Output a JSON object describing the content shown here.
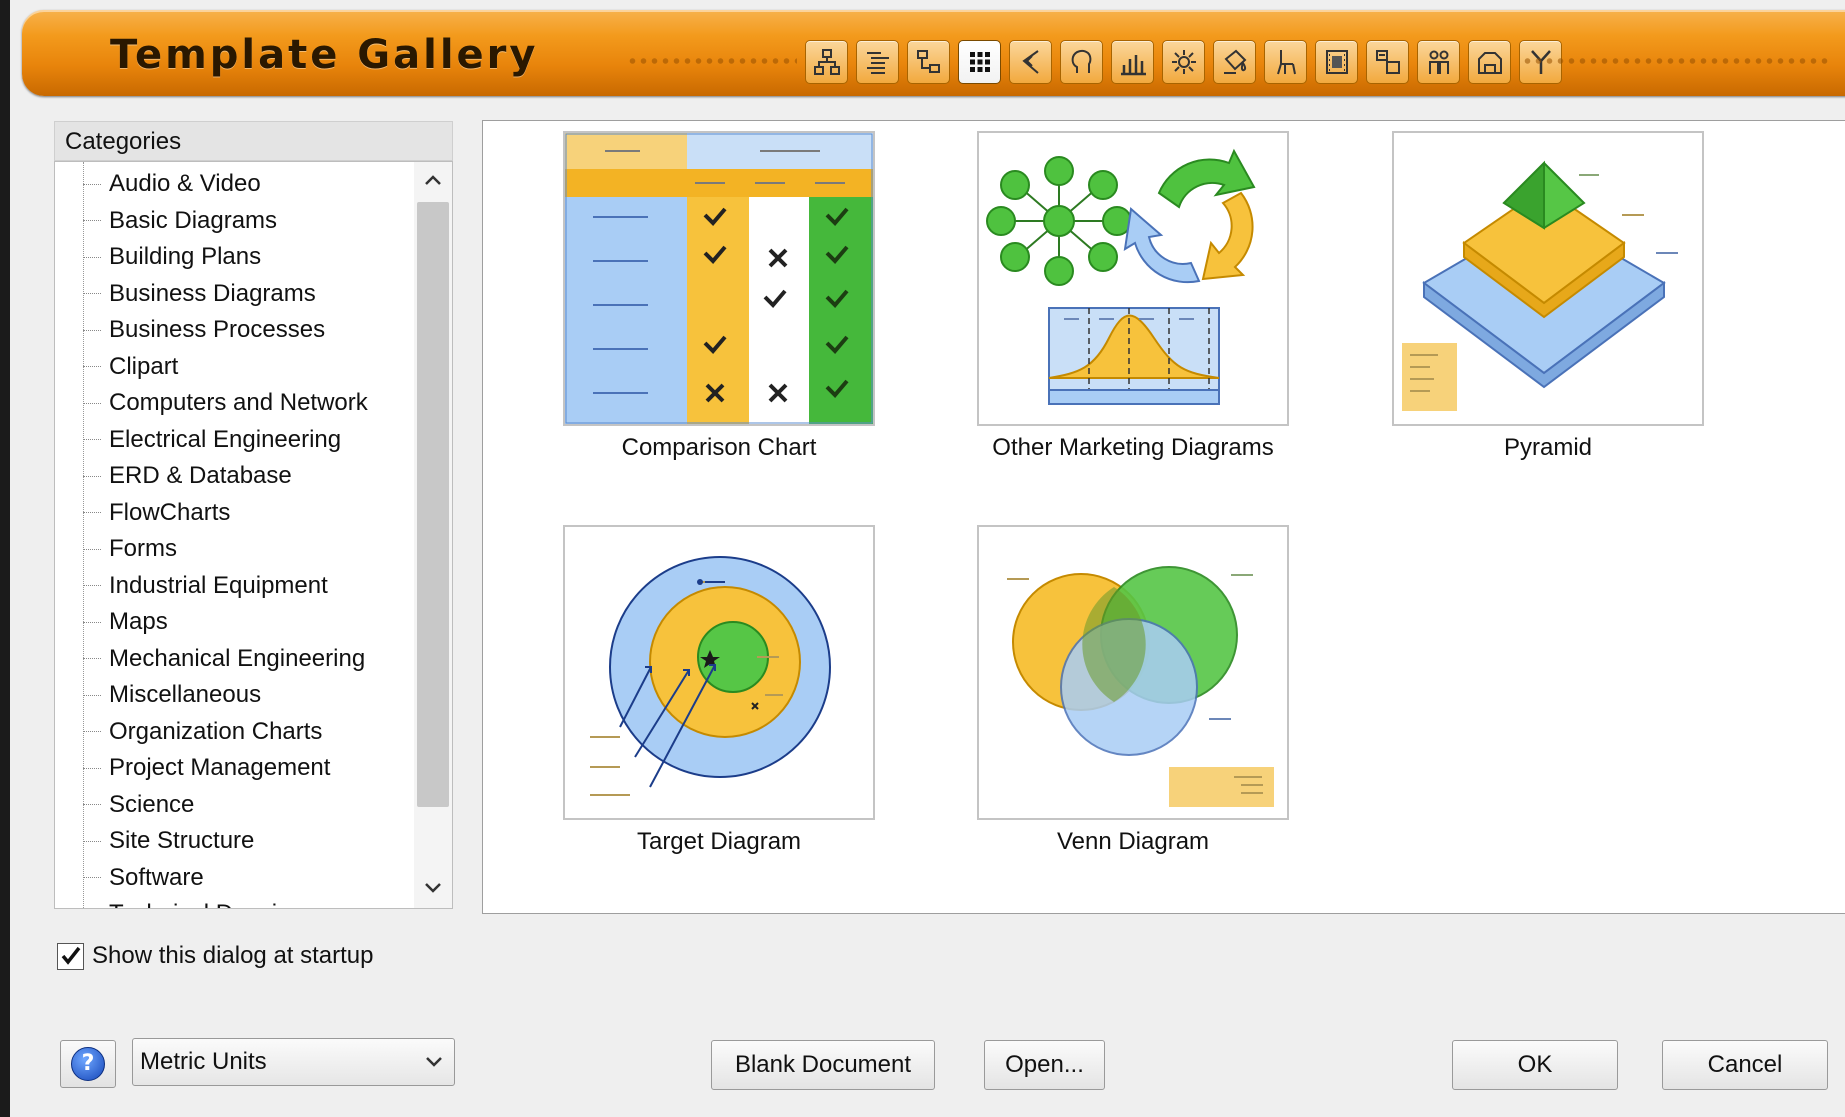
{
  "header": {
    "title": "Template Gallery",
    "toolbar_icons": [
      "hierarchy-icon",
      "indent-list-icon",
      "tree-icon",
      "grid-icon",
      "bracket-icon",
      "head-profile-icon",
      "bar-chart-icon",
      "sun-icon",
      "bucket-icon",
      "chair-icon",
      "filmstrip-icon",
      "blocks-icon",
      "people-icon",
      "building-icon",
      "branch-icon"
    ],
    "active_toolbar_index": 3
  },
  "categories": {
    "header": "Categories",
    "items": [
      "Audio & Video",
      "Basic Diagrams",
      "Building Plans",
      "Business Diagrams",
      "Business Processes",
      "Clipart",
      "Computers and Network",
      "Electrical Engineering",
      "ERD & Database",
      "FlowCharts",
      "Forms",
      "Industrial Equipment",
      "Maps",
      "Mechanical Engineering",
      "Miscellaneous",
      "Organization Charts",
      "Project Management",
      "Science",
      "Site Structure",
      "Software",
      "Technical Drawing"
    ],
    "scroll_up": "^",
    "scroll_down": "v"
  },
  "gallery": {
    "templates": [
      {
        "label": "Comparison Chart"
      },
      {
        "label": "Other Marketing Diagrams"
      },
      {
        "label": "Pyramid"
      },
      {
        "label": "Target Diagram"
      },
      {
        "label": "Venn Diagram"
      }
    ]
  },
  "footer": {
    "startup_label": "Show this dialog at startup",
    "startup_checked": true,
    "help_label": "?",
    "units_value": "Metric Units",
    "units_arrow": "⌄",
    "blank_document": "Blank Document",
    "open": "Open...",
    "ok": "OK",
    "cancel": "Cancel"
  },
  "colors": {
    "header_orange": "#f39a1c",
    "accent_blue": "#1546b8",
    "yellow": "#f7c23c",
    "green": "#45b83b",
    "light_blue": "#a9cdf5"
  }
}
